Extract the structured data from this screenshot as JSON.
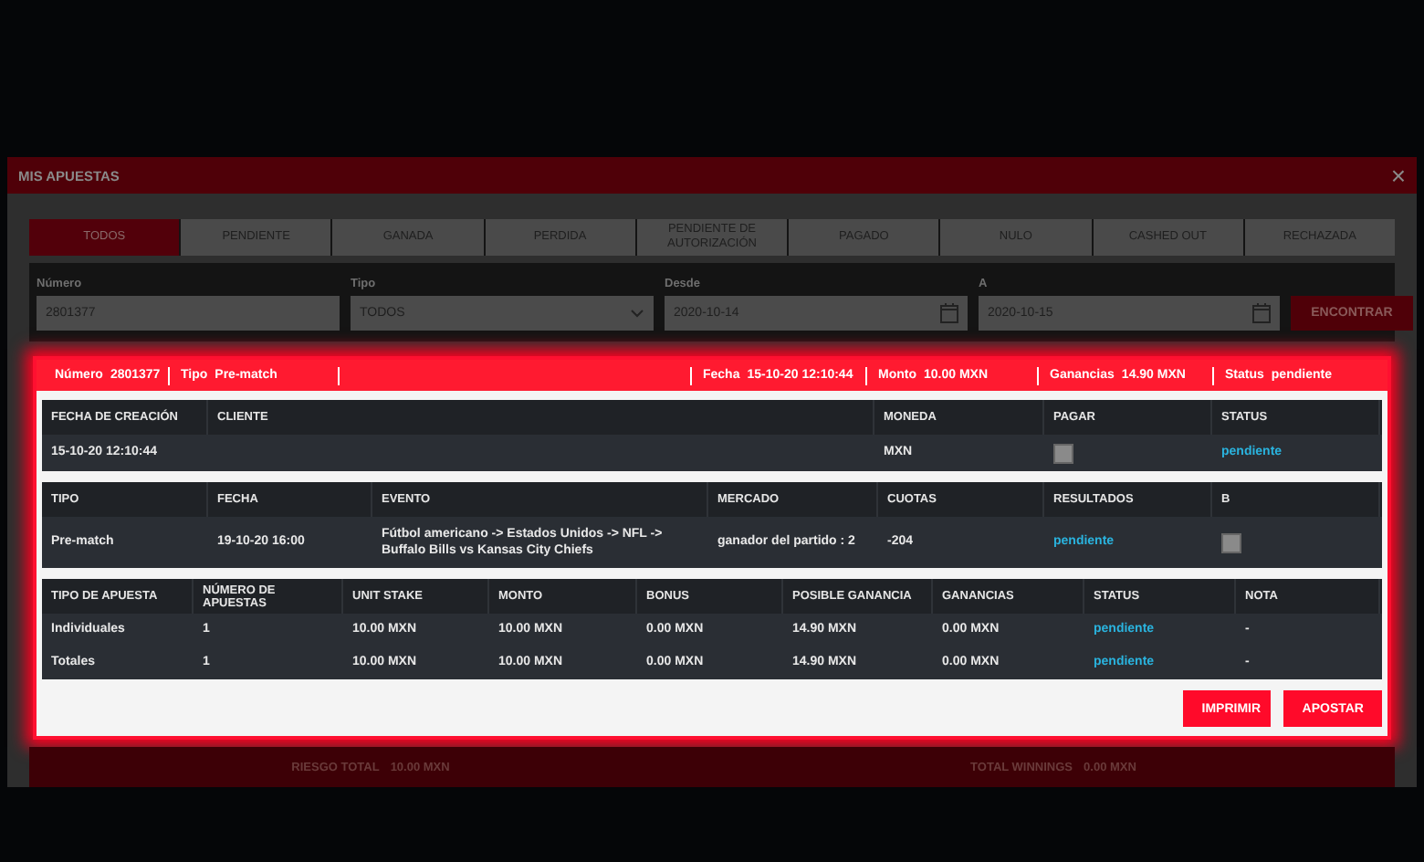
{
  "modal": {
    "title": "MIS APUESTAS",
    "close": "×"
  },
  "tabs": [
    {
      "label": "TODOS",
      "selected": true
    },
    {
      "label": "PENDIENTE",
      "selected": false
    },
    {
      "label": "GANADA",
      "selected": false
    },
    {
      "label": "PERDIDA",
      "selected": false
    },
    {
      "label": "PENDIENTE DE AUTORIZACIÓN",
      "selected": false
    },
    {
      "label": "PAGADO",
      "selected": false
    },
    {
      "label": "NULO",
      "selected": false
    },
    {
      "label": "CASHED OUT",
      "selected": false
    },
    {
      "label": "RECHAZADA",
      "selected": false
    }
  ],
  "filters": [
    {
      "kind": "text",
      "label": "Número",
      "value": "2801377"
    },
    {
      "kind": "select",
      "label": "Tipo",
      "value": "TODOS"
    },
    {
      "kind": "date",
      "label": "Desde",
      "value": "2020-10-14"
    },
    {
      "kind": "date",
      "label": "A",
      "value": "2020-10-15"
    }
  ],
  "search_button": "ENCONTRAR",
  "bet": {
    "summary": [
      {
        "label": "Número",
        "value": "2801377"
      },
      {
        "label": "Tipo",
        "value": "Pre-match"
      },
      {
        "label": "Fecha",
        "value": "15-10-20 12:10:44"
      },
      {
        "label": "Monto",
        "value": "10.00 MXN"
      },
      {
        "label": "Ganancias",
        "value": "14.90 MXN"
      },
      {
        "label": "Status",
        "value": "pendiente"
      }
    ],
    "tables": [
      {
        "columns": [
          "FECHA DE CREACIÓN",
          "CLIENTE",
          "MONEDA",
          "PAGAR",
          "STATUS"
        ],
        "rows": [
          [
            {
              "kind": "text",
              "text": "15-10-20 12:10:44"
            },
            {
              "kind": "blank"
            },
            {
              "kind": "text",
              "text": "MXN"
            },
            {
              "kind": "checkbox",
              "checked": false
            },
            {
              "kind": "status",
              "text": "pendiente"
            }
          ]
        ]
      },
      {
        "columns": [
          "TIPO",
          "FECHA",
          "EVENTO",
          "MERCADO",
          "CUOTAS",
          "RESULTADOS",
          "B"
        ],
        "rows": [
          [
            {
              "kind": "text",
              "text": "Pre-match"
            },
            {
              "kind": "text",
              "text": "19-10-20 16:00"
            },
            {
              "kind": "text",
              "text": "Fútbol americano -> Estados Unidos -> NFL -> Buffalo Bills vs Kansas City Chiefs"
            },
            {
              "kind": "text",
              "text": "ganador del partido : 2"
            },
            {
              "kind": "text",
              "text": "-204"
            },
            {
              "kind": "status",
              "text": "pendiente"
            },
            {
              "kind": "checkbox",
              "checked": false
            }
          ]
        ]
      },
      {
        "columns": [
          "TIPO DE APUESTA",
          "NÚMERO DE APUESTAS",
          "UNIT STAKE",
          "MONTO",
          "BONUS",
          "POSIBLE GANANCIA",
          "GANANCIAS",
          "STATUS",
          "NOTA"
        ],
        "rows": [
          [
            {
              "kind": "text",
              "text": "Individuales"
            },
            {
              "kind": "text",
              "text": "1"
            },
            {
              "kind": "text",
              "text": "10.00 MXN"
            },
            {
              "kind": "text",
              "text": "10.00 MXN"
            },
            {
              "kind": "text",
              "text": "0.00 MXN"
            },
            {
              "kind": "text",
              "text": "14.90 MXN"
            },
            {
              "kind": "text",
              "text": "0.00 MXN"
            },
            {
              "kind": "status",
              "text": "pendiente"
            },
            {
              "kind": "text",
              "text": "-"
            }
          ],
          [
            {
              "kind": "text",
              "text": "Totales"
            },
            {
              "kind": "text",
              "text": "1"
            },
            {
              "kind": "text",
              "text": "10.00 MXN"
            },
            {
              "kind": "text",
              "text": "10.00 MXN"
            },
            {
              "kind": "text",
              "text": "0.00 MXN"
            },
            {
              "kind": "text",
              "text": "14.90 MXN"
            },
            {
              "kind": "text",
              "text": "0.00 MXN"
            },
            {
              "kind": "status",
              "text": "pendiente"
            },
            {
              "kind": "text",
              "text": "-"
            }
          ]
        ]
      }
    ],
    "buttons": [
      "IMPRIMIR",
      "APOSTAR"
    ]
  },
  "footer": [
    {
      "label": "RIESGO TOTAL",
      "value": "10.00 MXN"
    },
    {
      "label": "TOTAL WINNINGS",
      "value": "0.00 MXN"
    }
  ]
}
